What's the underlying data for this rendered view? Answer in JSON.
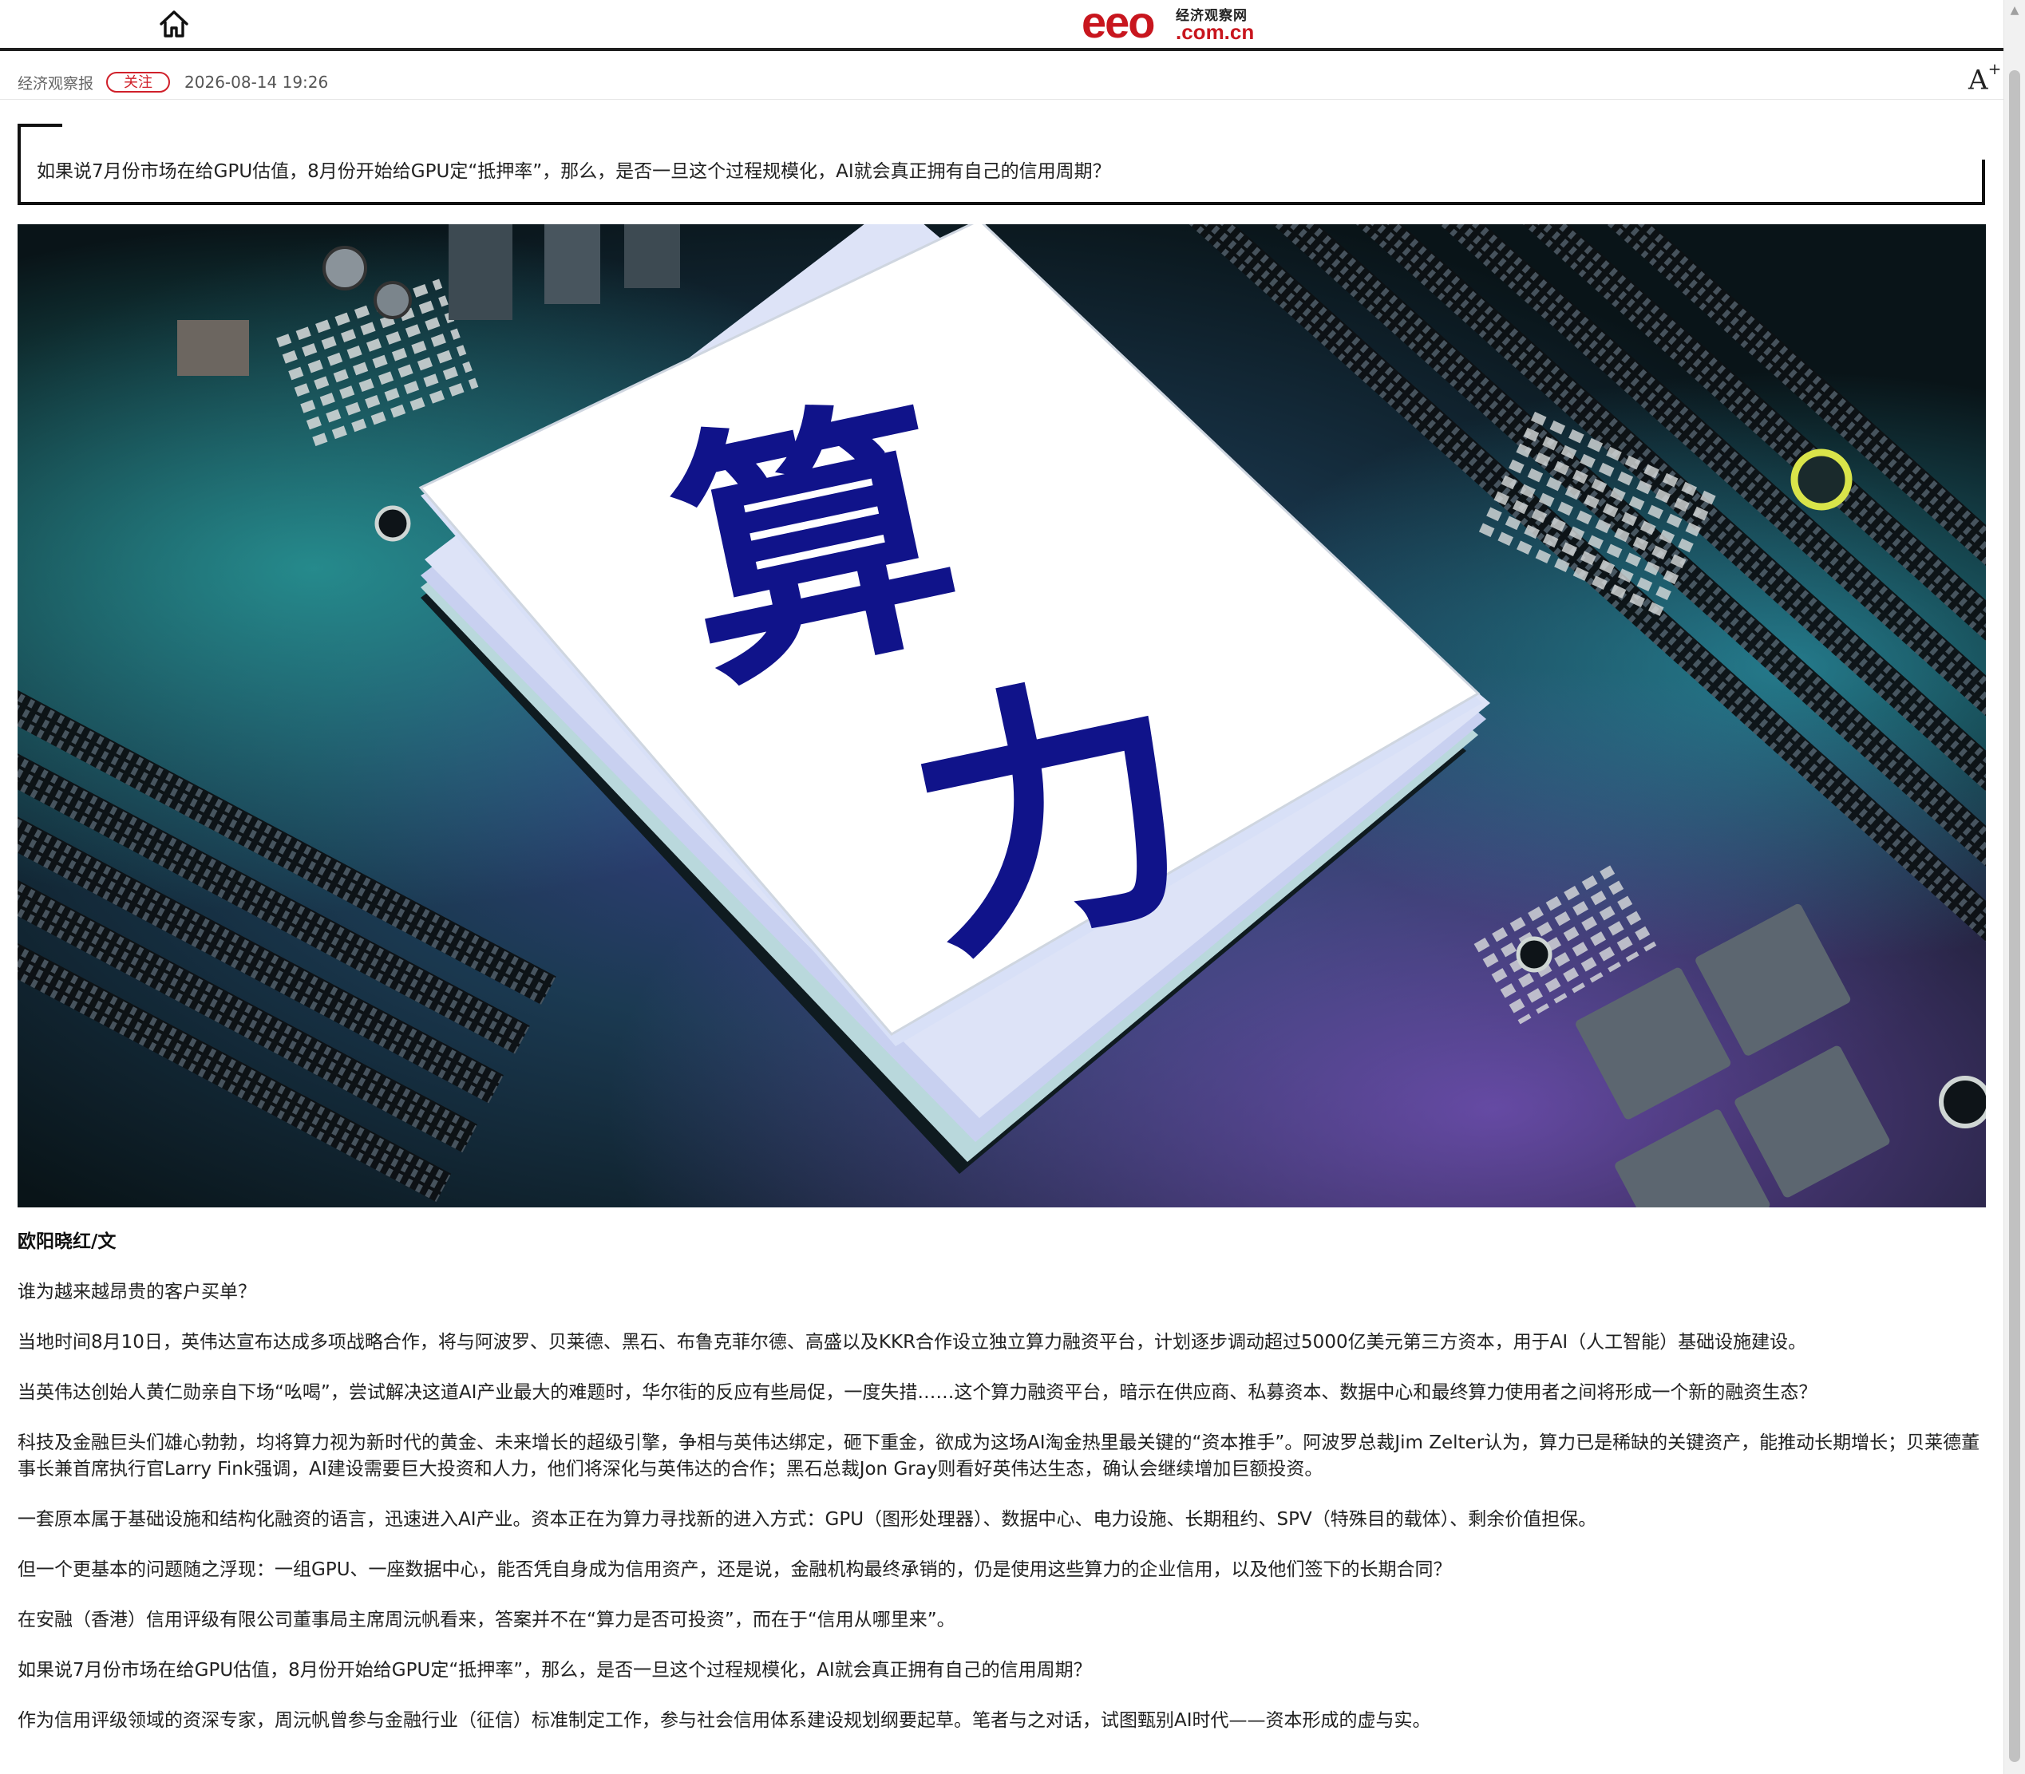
{
  "header": {
    "home_icon": "home-icon",
    "logo_latin": "eeo",
    "logo_cn": "经济观察网",
    "logo_domain": ".com.cn"
  },
  "meta": {
    "source": "经济观察报",
    "follow_label": "关注",
    "datetime": "2026-08-14 19:26",
    "font_button": "A",
    "font_button_sup": "+"
  },
  "summary": "如果说7月份市场在给GPU估值，8月份开始给GPU定“抵押率”，那么，是否一旦这个过程规模化，AI就会真正拥有自己的信用周期？",
  "hero": {
    "chip_text_1": "算",
    "chip_text_2": "力",
    "chip_color": "#10138a"
  },
  "article": {
    "author": "欧阳晓红/文",
    "paragraphs": [
      "谁为越来越昂贵的客户买单？",
      "当地时间8月10日，英伟达宣布达成多项战略合作，将与阿波罗、贝莱德、黑石、布鲁克菲尔德、高盛以及KKR合作设立独立算力融资平台，计划逐步调动超过5000亿美元第三方资本，用于AI（人工智能）基础设施建设。",
      "当英伟达创始人黄仁勋亲自下场“吆喝”，尝试解决这道AI产业最大的难题时，华尔街的反应有些局促，一度失措……这个算力融资平台，暗示在供应商、私募资本、数据中心和最终算力使用者之间将形成一个新的融资生态？",
      "科技及金融巨头们雄心勃勃，均将算力视为新时代的黄金、未来增长的超级引擎，争相与英伟达绑定，砸下重金，欲成为这场AI淘金热里最关键的“资本推手”。阿波罗总裁Jim Zelter认为，算力已是稀缺的关键资产，能推动长期增长；贝莱德董事长兼首席执行官Larry Fink强调，AI建设需要巨大投资和人力，他们将深化与英伟达的合作；黑石总裁Jon Gray则看好英伟达生态，确认会继续增加巨额投资。",
      "一套原本属于基础设施和结构化融资的语言，迅速进入AI产业。资本正在为算力寻找新的进入方式：GPU（图形处理器）、数据中心、电力设施、长期租约、SPV（特殊目的载体）、剩余价值担保。",
      "但一个更基本的问题随之浮现：一组GPU、一座数据中心，能否凭自身成为信用资产，还是说，金融机构最终承销的，仍是使用这些算力的企业信用，以及他们签下的长期合同？",
      "在安融（香港）信用评级有限公司董事局主席周沅帆看来，答案并不在“算力是否可投资”，而在于“信用从哪里来”。",
      "如果说7月份市场在给GPU估值，8月份开始给GPU定“抵押率”，那么，是否一旦这个过程规模化，AI就会真正拥有自己的信用周期？",
      "作为信用评级领域的资深专家，周沅帆曾参与金融行业（征信）标准制定工作，参与社会信用体系建设规划纲要起草。笔者与之对话，试图甄别AI时代——资本形成的虚与实。"
    ]
  },
  "scrollbar": {
    "up_arrow": "▲"
  }
}
